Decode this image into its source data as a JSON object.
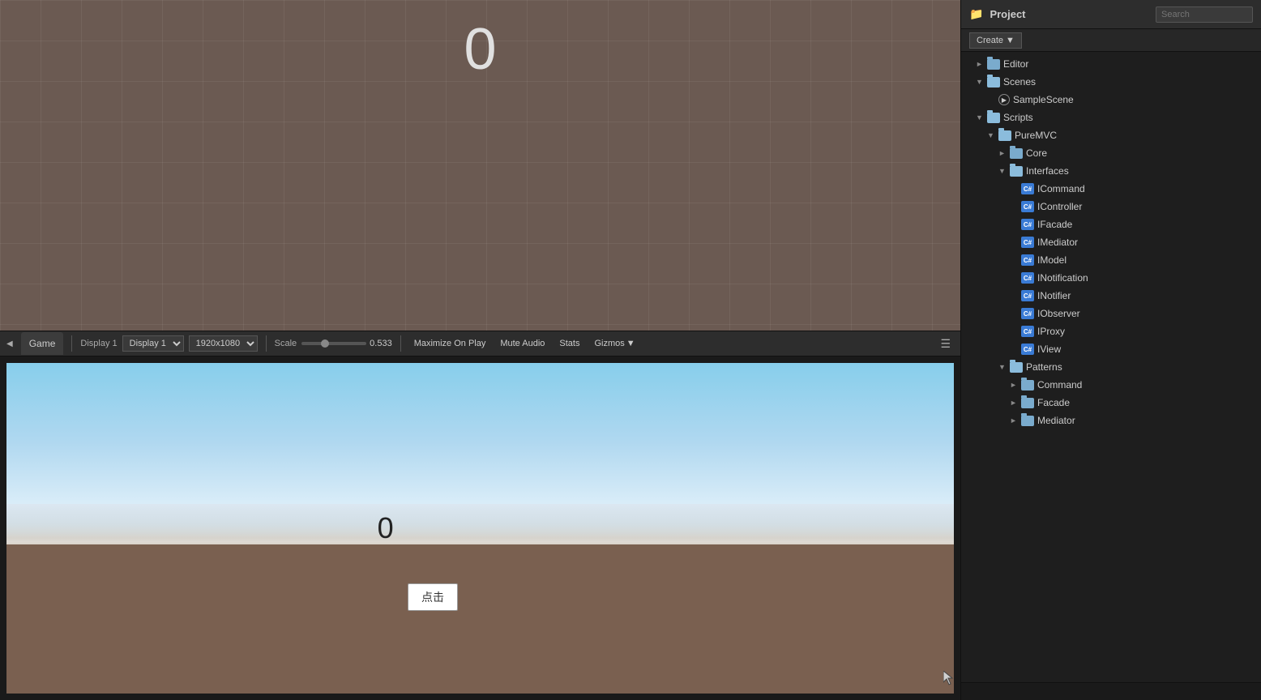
{
  "scene": {
    "score": "0"
  },
  "game_toolbar": {
    "tab_label": "Game",
    "display_label": "Display 1",
    "resolution": "1920x1080",
    "scale_label": "Scale",
    "scale_value": "0.533",
    "maximize_label": "Maximize On Play",
    "mute_label": "Mute Audio",
    "stats_label": "Stats",
    "gizmos_label": "Gizmos"
  },
  "game_view": {
    "score": "0",
    "button_label": "点击"
  },
  "project_panel": {
    "title": "Project",
    "create_label": "Create",
    "search_placeholder": "Search",
    "tree": [
      {
        "id": "editor",
        "label": "Editor",
        "type": "folder",
        "indent": 1,
        "arrow": "►",
        "expanded": false
      },
      {
        "id": "scenes",
        "label": "Scenes",
        "type": "folder",
        "indent": 1,
        "arrow": "▼",
        "expanded": true
      },
      {
        "id": "samplescene",
        "label": "SampleScene",
        "type": "scene",
        "indent": 2,
        "arrow": ""
      },
      {
        "id": "scripts",
        "label": "Scripts",
        "type": "folder",
        "indent": 1,
        "arrow": "▼",
        "expanded": true
      },
      {
        "id": "puremvc",
        "label": "PureMVC",
        "type": "folder",
        "indent": 2,
        "arrow": "▼",
        "expanded": true
      },
      {
        "id": "core",
        "label": "Core",
        "type": "folder",
        "indent": 3,
        "arrow": "►",
        "expanded": false
      },
      {
        "id": "interfaces",
        "label": "Interfaces",
        "type": "folder",
        "indent": 3,
        "arrow": "▼",
        "expanded": true
      },
      {
        "id": "icommand",
        "label": "ICommand",
        "type": "cs",
        "indent": 4,
        "arrow": ""
      },
      {
        "id": "icontroller",
        "label": "IController",
        "type": "cs",
        "indent": 4,
        "arrow": ""
      },
      {
        "id": "ifacade",
        "label": "IFacade",
        "type": "cs",
        "indent": 4,
        "arrow": ""
      },
      {
        "id": "imediator",
        "label": "IMediator",
        "type": "cs",
        "indent": 4,
        "arrow": ""
      },
      {
        "id": "imodel",
        "label": "IModel",
        "type": "cs",
        "indent": 4,
        "arrow": ""
      },
      {
        "id": "inotification",
        "label": "INotification",
        "type": "cs",
        "indent": 4,
        "arrow": ""
      },
      {
        "id": "inotifier",
        "label": "INotifier",
        "type": "cs",
        "indent": 4,
        "arrow": ""
      },
      {
        "id": "iobserver",
        "label": "IObserver",
        "type": "cs",
        "indent": 4,
        "arrow": ""
      },
      {
        "id": "iproxy",
        "label": "IProxy",
        "type": "cs",
        "indent": 4,
        "arrow": ""
      },
      {
        "id": "iview",
        "label": "IView",
        "type": "cs",
        "indent": 4,
        "arrow": ""
      },
      {
        "id": "patterns",
        "label": "Patterns",
        "type": "folder",
        "indent": 3,
        "arrow": "▼",
        "expanded": true
      },
      {
        "id": "command",
        "label": "Command",
        "type": "folder",
        "indent": 4,
        "arrow": "►",
        "expanded": false
      },
      {
        "id": "facade",
        "label": "Facade",
        "type": "folder",
        "indent": 4,
        "arrow": "►",
        "expanded": false
      },
      {
        "id": "mediator",
        "label": "Mediator",
        "type": "folder",
        "indent": 4,
        "arrow": "►",
        "expanded": false
      }
    ]
  }
}
